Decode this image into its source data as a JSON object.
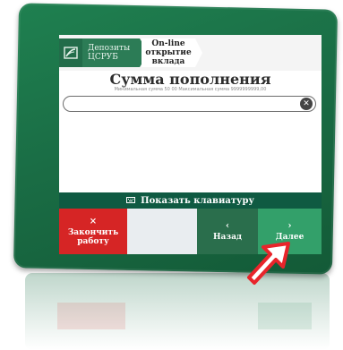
{
  "header": {
    "crumb_deposits_line1": "Депозиты",
    "crumb_deposits_line2": "ЦСРУБ",
    "crumb_online_line1": "On-line",
    "crumb_online_line2": "открытие",
    "crumb_online_line3": "вклада"
  },
  "main": {
    "title": "Сумма пополнения",
    "subtitle": "Минимальная сумма 50 00 Максимальная сумма 9999999999,00",
    "amount_value": ""
  },
  "keyboard_bar": {
    "label": "Показать клавиатуру",
    "icon": "keyboard-icon"
  },
  "buttons": {
    "finish_glyph": "×",
    "finish_label_line1": "Закончить",
    "finish_label_line2": "работу",
    "back_glyph": "‹",
    "back_label": "Назад",
    "next_glyph": "›",
    "next_label": "Далее"
  },
  "colors": {
    "frame": "#1a6d45",
    "header_crumb": "#2c7c56",
    "keyboard_bar": "#0f5a42",
    "finish_button": "#d62525",
    "back_button": "#2a6e4c",
    "next_button": "#33a06a",
    "pointer": "#e8252b"
  }
}
